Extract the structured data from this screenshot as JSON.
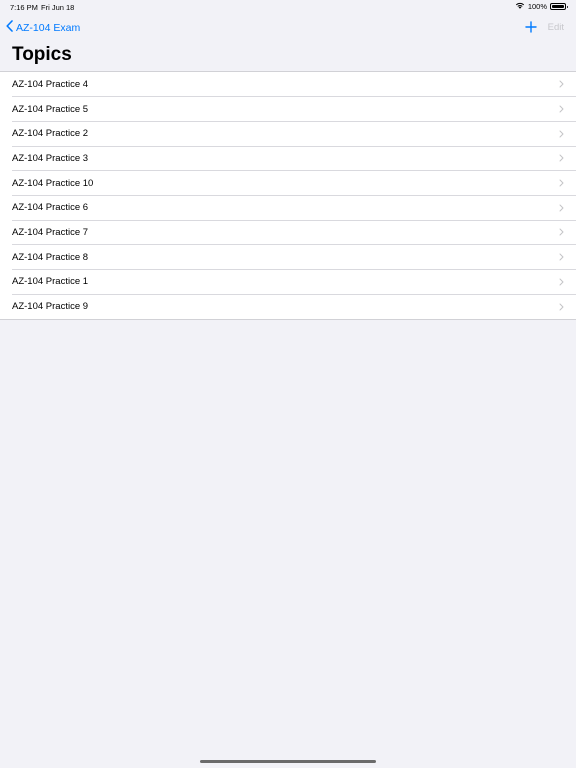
{
  "status_bar": {
    "time": "7:16 PM",
    "date": "Fri Jun 18",
    "battery": "100%"
  },
  "nav": {
    "back_label": "AZ-104 Exam",
    "edit_label": "Edit"
  },
  "page": {
    "title": "Topics"
  },
  "topics": [
    {
      "label": "AZ-104 Practice 4"
    },
    {
      "label": "AZ-104 Practice 5"
    },
    {
      "label": "AZ-104 Practice 2"
    },
    {
      "label": "AZ-104 Practice 3"
    },
    {
      "label": "AZ-104 Practice 10"
    },
    {
      "label": "AZ-104 Practice 6"
    },
    {
      "label": "AZ-104 Practice 7"
    },
    {
      "label": "AZ-104 Practice 8"
    },
    {
      "label": "AZ-104 Practice 1"
    },
    {
      "label": "AZ-104 Practice 9"
    }
  ],
  "colors": {
    "accent": "#007aff",
    "background": "#f2f2f7",
    "disabled": "#c7c7cc"
  },
  "icons": {
    "back": "chevron-left-icon",
    "add": "plus-icon",
    "row": "chevron-right-icon",
    "wifi": "wifi-icon",
    "battery": "battery-icon"
  }
}
